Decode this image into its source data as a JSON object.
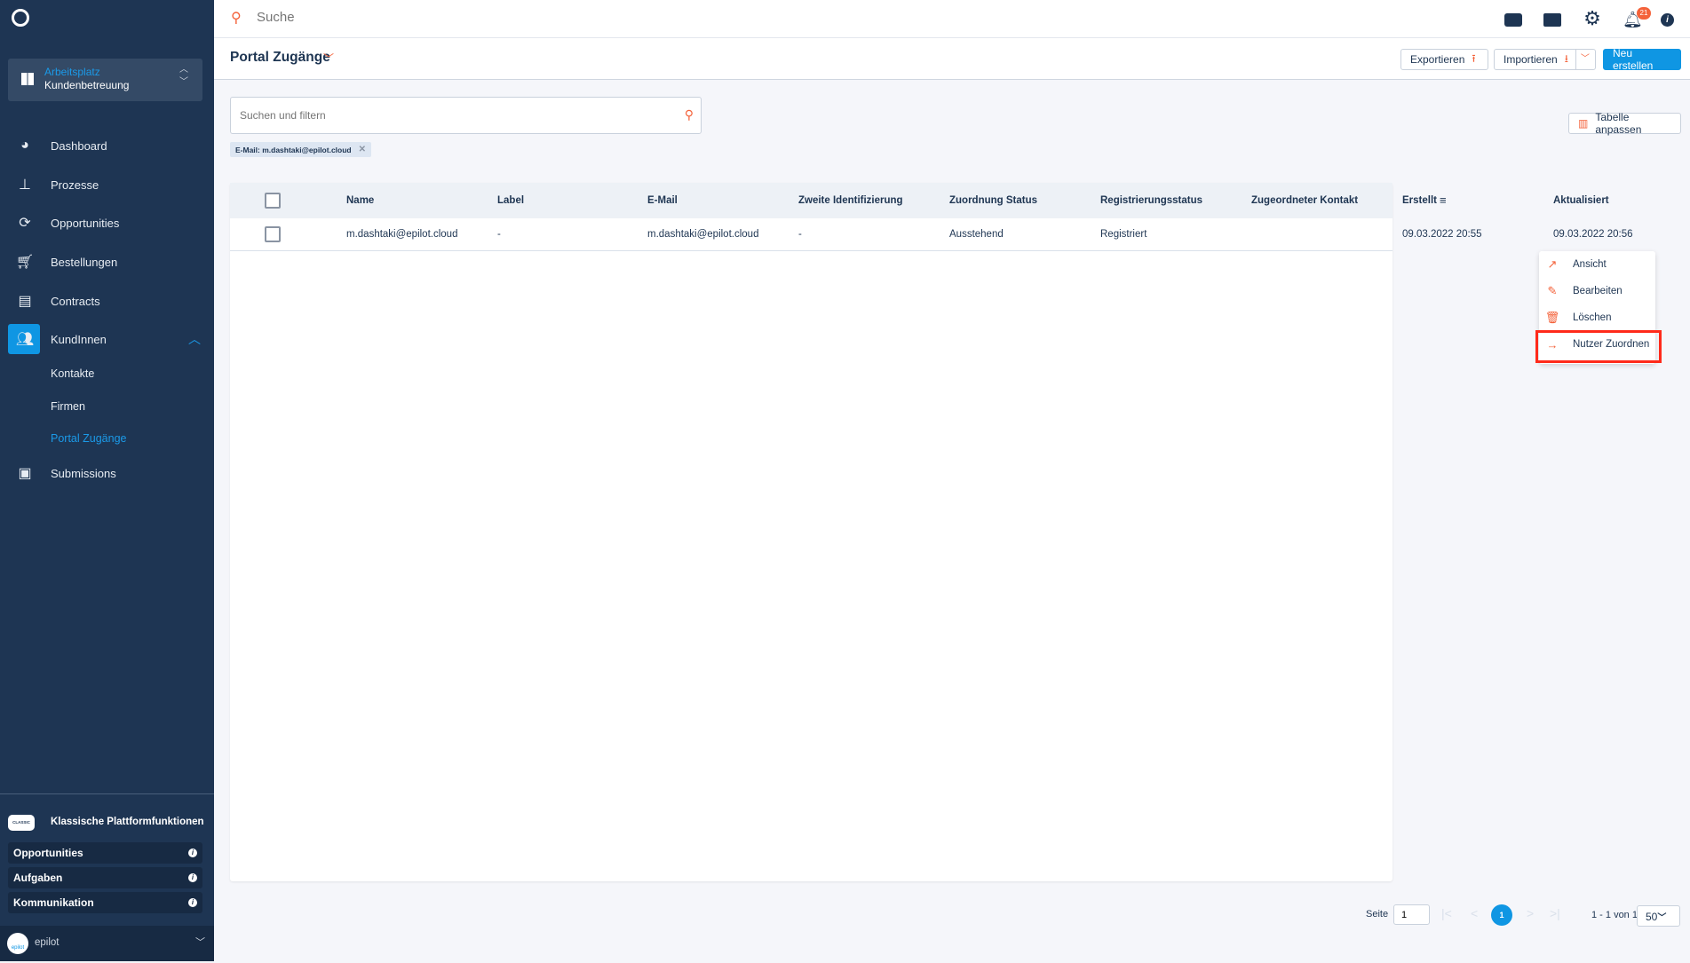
{
  "app": {
    "search_placeholder": "Suche",
    "notification_count": "21"
  },
  "sidebar": {
    "workspace": {
      "label": "Arbeitsplatz",
      "value": "Kundenbetreuung"
    },
    "items": [
      {
        "label": "Dashboard",
        "icon": "pie-chart-icon"
      },
      {
        "label": "Prozesse",
        "icon": "sitemap-icon"
      },
      {
        "label": "Opportunities",
        "icon": "sync-icon"
      },
      {
        "label": "Bestellungen",
        "icon": "cart-icon"
      },
      {
        "label": "Contracts",
        "icon": "clipboard-icon"
      },
      {
        "label": "KundInnen",
        "icon": "users-icon",
        "active": true
      }
    ],
    "subitems": [
      {
        "label": "Kontakte"
      },
      {
        "label": "Firmen"
      },
      {
        "label": "Portal Zugänge",
        "active": true
      }
    ],
    "submissions": {
      "label": "Submissions",
      "icon": "inbox-icon"
    },
    "classic": {
      "badge": "CLASSIC",
      "title": "Klassische Plattformfunktionen",
      "items": [
        "Opportunities",
        "Aufgaben",
        "Kommunikation"
      ]
    },
    "org": {
      "name": "epilot",
      "logo_text": "epilot"
    }
  },
  "page": {
    "title": "Portal Zugänge",
    "export": "Exportieren",
    "import": "Importieren",
    "create": "Neu erstellen",
    "table_adjust": "Tabelle anpassen",
    "filter_placeholder": "Suchen und filtern",
    "chip": "E-Mail: m.dashtaki@epilot.cloud"
  },
  "table": {
    "columns": [
      "Name",
      "Label",
      "E-Mail",
      "Zweite Identifizierung",
      "Zuordnung Status",
      "Registrierungsstatus",
      "Zugeordneter Kontakt",
      "Erstellt",
      "Aktualisiert"
    ],
    "rows": [
      [
        "m.dashtaki@epilot.cloud",
        "-",
        "m.dashtaki@epilot.cloud",
        "-",
        "Ausstehend",
        "Registriert",
        "",
        "09.03.2022 20:55",
        "09.03.2022 20:56"
      ]
    ]
  },
  "context_menu": {
    "items": [
      {
        "label": "Ansicht",
        "icon": "open-external-icon"
      },
      {
        "label": "Bearbeiten",
        "icon": "pencil-icon"
      },
      {
        "label": "Löschen",
        "icon": "trash-icon"
      },
      {
        "label": "Nutzer Zuordnen",
        "icon": "arrow-right-icon",
        "highlighted": true
      }
    ]
  },
  "pagination": {
    "page_label": "Seite",
    "page_value": "1",
    "current": "1",
    "range": "1 - 1 von 1",
    "page_size": "50"
  },
  "colors": {
    "sidebar": "#1e3553",
    "accent": "#0f96e3",
    "orange": "#f4623a",
    "highlight": "#ff2a1a"
  }
}
